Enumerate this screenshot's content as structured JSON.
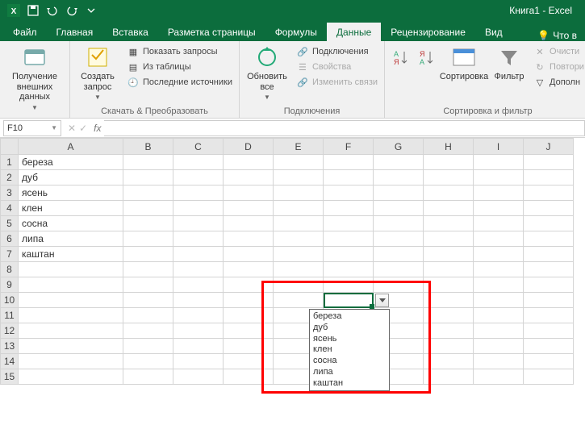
{
  "titlebar": {
    "title": "Книга1 - Excel"
  },
  "tabs": {
    "file": "Файл",
    "items": [
      {
        "label": "Главная"
      },
      {
        "label": "Вставка"
      },
      {
        "label": "Разметка страницы"
      },
      {
        "label": "Формулы"
      },
      {
        "label": "Данные",
        "active": true
      },
      {
        "label": "Рецензирование"
      },
      {
        "label": "Вид"
      }
    ],
    "tell_me": "Что в"
  },
  "ribbon": {
    "group1": {
      "get_data": "Получение\nвнешних данных",
      "new_query": "Создать\nзапрос",
      "show_queries": "Показать запросы",
      "from_table": "Из таблицы",
      "recent": "Последние источники",
      "label": "Скачать & Преобразовать"
    },
    "group2": {
      "refresh": "Обновить\nвсе",
      "connections": "Подключения",
      "properties": "Свойства",
      "edit_links": "Изменить связи",
      "label": "Подключения"
    },
    "group3": {
      "sort": "Сортировка",
      "filter": "Фильтр",
      "clear": "Очисти",
      "reapply": "Повтори",
      "advanced": "Дополн",
      "label": "Сортировка и фильтр"
    }
  },
  "namebox": "F10",
  "columns": [
    "A",
    "B",
    "C",
    "D",
    "E",
    "F",
    "G",
    "H",
    "I",
    "J"
  ],
  "rows": [
    1,
    2,
    3,
    4,
    5,
    6,
    7,
    8,
    9,
    10,
    11,
    12,
    13,
    14,
    15
  ],
  "data_A": [
    "береза",
    "дуб",
    "ясень",
    "клен",
    "сосна",
    "липа",
    "каштан"
  ],
  "dropdown": [
    "береза",
    "дуб",
    "ясень",
    "клен",
    "сосна",
    "липа",
    "каштан"
  ]
}
